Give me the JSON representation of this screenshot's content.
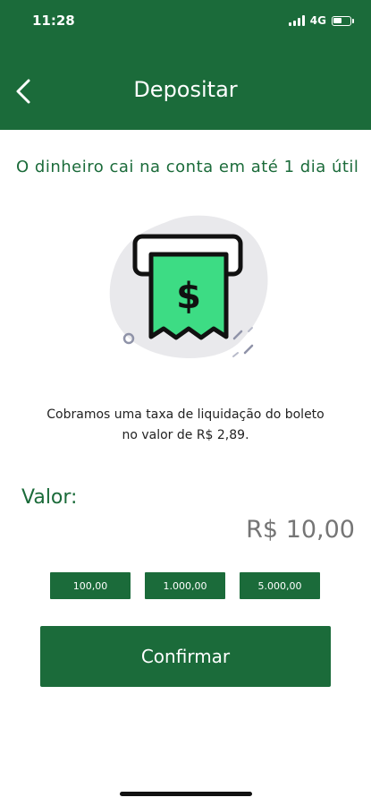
{
  "status_bar": {
    "time": "11:28",
    "network": "4G"
  },
  "header": {
    "title": "Depositar",
    "back_icon": "chevron-left-icon"
  },
  "info": {
    "text": "O dinheiro cai na conta em até 1 dia útil"
  },
  "illustration": {
    "icon": "boleto-dollar-receipt-icon",
    "accent_color": "#3ddc84"
  },
  "fee": {
    "line1": "Cobramos uma taxa de liquidação do boleto",
    "line2": "no valor de R$ 2,89."
  },
  "amount": {
    "label": "Valor:",
    "value": "R$ 10,00"
  },
  "quick_amounts": [
    {
      "label": "100,00"
    },
    {
      "label": "1.000,00"
    },
    {
      "label": "5.000,00"
    }
  ],
  "confirm": {
    "label": "Confirmar"
  },
  "colors": {
    "primary": "#1b6b3a",
    "accent": "#3ddc84",
    "muted_text": "#757575"
  }
}
